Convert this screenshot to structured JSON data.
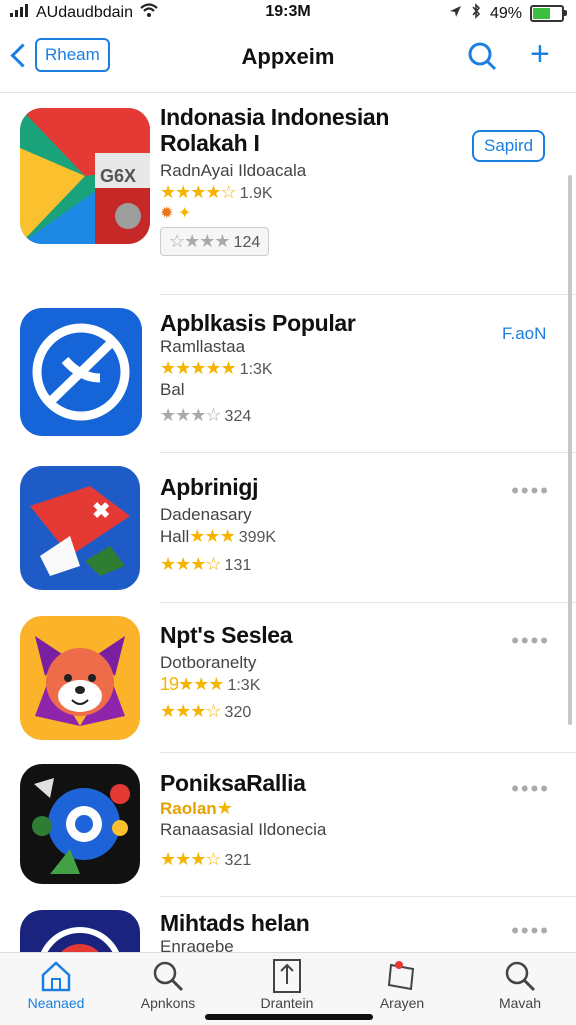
{
  "status": {
    "carrier": "AUdaudbdain",
    "time": "19:3M",
    "battery": "49%"
  },
  "nav": {
    "back_label": "Rheam",
    "title": "Appxeim"
  },
  "apps": [
    {
      "name": "Indonasia Indonesian",
      "name2": "Rolakah I",
      "subtitle": "RadnAyai Ildoacala",
      "stars": "★★★★☆",
      "rating_count": "1.9K",
      "extra": "",
      "small_stars": "☆★★★",
      "small_count": "124",
      "action": "Sapird"
    },
    {
      "name": "Apblkasis Popular",
      "subtitle": "Ramllastaa",
      "stars": "★★★★★",
      "rating_count": "1:3K",
      "extra": "Bal",
      "small_stars": "★★★☆",
      "small_count": "324",
      "action": "F.aoN"
    },
    {
      "name": "Apbrinigj",
      "subtitle": "Dadenasary",
      "stars_prefix": "Hall",
      "stars": "★★★",
      "rating_count": "399K",
      "small_stars": "★★★☆",
      "small_count": "131"
    },
    {
      "name": "Npt's Seslea",
      "subtitle": "Dotboranelty",
      "stars_prefix": "19",
      "stars": "★★★",
      "rating_count": "1:3K",
      "small_stars": "★★★☆",
      "small_count": "320"
    },
    {
      "name": "PoniksaRallia",
      "subtitle": "Raolan",
      "stars": "★",
      "rating_count": "",
      "extra": "Ranaasasial Ildonecia",
      "small_stars": "★★★☆",
      "small_count": "321"
    },
    {
      "name": "Mihtads helan",
      "subtitle": "Enragebe"
    }
  ],
  "more_label": "••••",
  "tabs": [
    {
      "label": "Neanaed",
      "icon": "home-icon"
    },
    {
      "label": "Apnkons",
      "icon": "search-icon"
    },
    {
      "label": "Drantein",
      "icon": "upload-icon"
    },
    {
      "label": "Arayen",
      "icon": "bookmark-icon"
    },
    {
      "label": "Mavah",
      "icon": "search-icon"
    }
  ],
  "colors": {
    "accent": "#1a7fe0",
    "star": "#f4b400"
  }
}
